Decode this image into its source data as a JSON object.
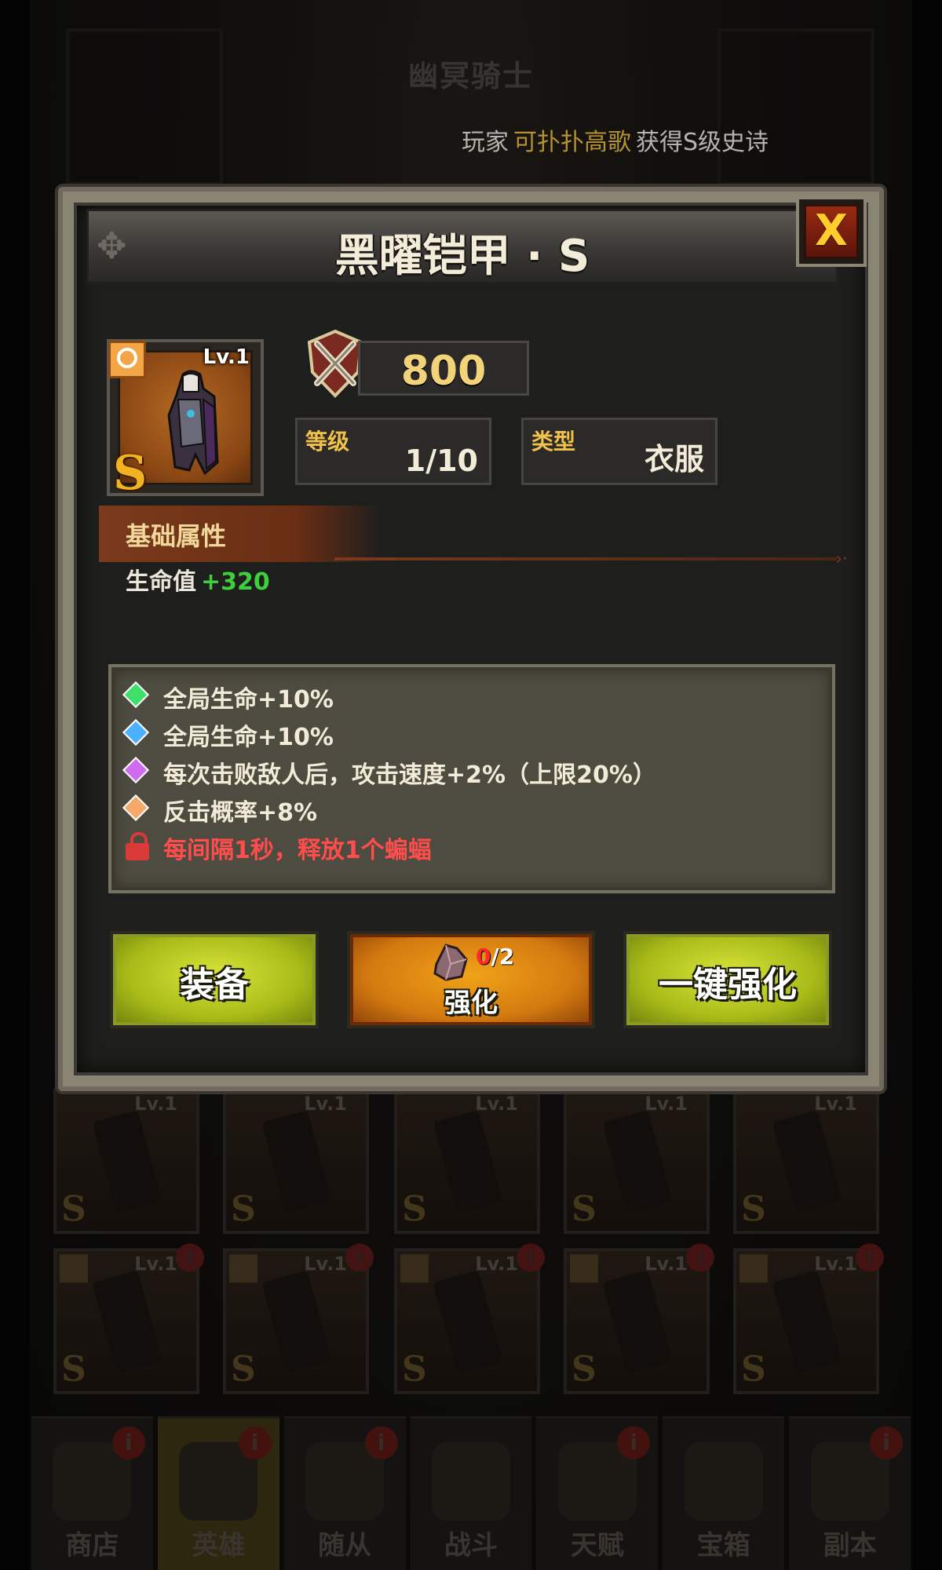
{
  "header": {
    "title": "幽冥骑士",
    "notice_prefix": "玩家",
    "notice_player": "可扑扑高歌",
    "notice_suffix": "获得S级史诗"
  },
  "modal": {
    "title": "黑曜铠甲 · S",
    "close_label": "X",
    "item": {
      "level_label": "Lv.1",
      "grade": "S"
    },
    "power": "800",
    "level": {
      "label": "等级",
      "value": "1/10"
    },
    "type": {
      "label": "类型",
      "value": "衣服"
    },
    "section_title": "基础属性",
    "basic_attr": {
      "label": "生命值",
      "value": "+320"
    },
    "skills": [
      {
        "text": "全局生命+10%",
        "gem": "green",
        "color": "#3ee06a",
        "locked": false
      },
      {
        "text": "全局生命+10%",
        "gem": "blue",
        "color": "#4ab0ff",
        "locked": false
      },
      {
        "text": "每次击败敌人后，攻击速度+2%（上限20%）",
        "gem": "purple",
        "color": "#d06af0",
        "locked": false
      },
      {
        "text": "反击概率+8%",
        "gem": "orange",
        "color": "#f4a86a",
        "locked": false
      },
      {
        "text": "每间隔1秒，释放1个蝙蝠",
        "gem": "lock-icon",
        "color": "#d83a3a",
        "locked": true
      }
    ],
    "buttons": {
      "equip": "装备",
      "upgrade": "强化",
      "upgrade_cost_have": "0",
      "upgrade_cost_need": "/2",
      "auto_upgrade": "一键强化"
    }
  },
  "background_grid": {
    "rows": [
      [
        {
          "grade": "S",
          "lv": "Lv.1"
        },
        {
          "grade": "S",
          "lv": "Lv.1"
        },
        {
          "grade": "S",
          "lv": "Lv.1"
        },
        {
          "grade": "S",
          "lv": "Lv.1"
        },
        {
          "grade": "S",
          "lv": "Lv.1"
        }
      ],
      [
        {
          "grade": "S",
          "lv": "Lv.1"
        },
        {
          "grade": "S",
          "lv": "Lv.1"
        },
        {
          "grade": "S",
          "lv": "Lv.1"
        },
        {
          "grade": "S",
          "lv": "Lv.1"
        },
        {
          "grade": "S",
          "lv": "Lv.1"
        }
      ]
    ]
  },
  "nav": {
    "items": [
      {
        "label": "商店",
        "icon": "bag-icon",
        "badge": "i",
        "active": false
      },
      {
        "label": "英雄",
        "icon": "helmet-icon",
        "badge": "i",
        "active": true
      },
      {
        "label": "随从",
        "icon": "companion-icon",
        "badge": "i",
        "active": false
      },
      {
        "label": "战斗",
        "icon": "crossed-swords-icon",
        "badge": "",
        "active": false
      },
      {
        "label": "天赋",
        "icon": "shield-arrow-icon",
        "badge": "i",
        "active": false
      },
      {
        "label": "宝箱",
        "icon": "chest-icon",
        "badge": "",
        "active": false
      },
      {
        "label": "副本",
        "icon": "scroll-icon",
        "badge": "i",
        "active": false
      }
    ]
  }
}
